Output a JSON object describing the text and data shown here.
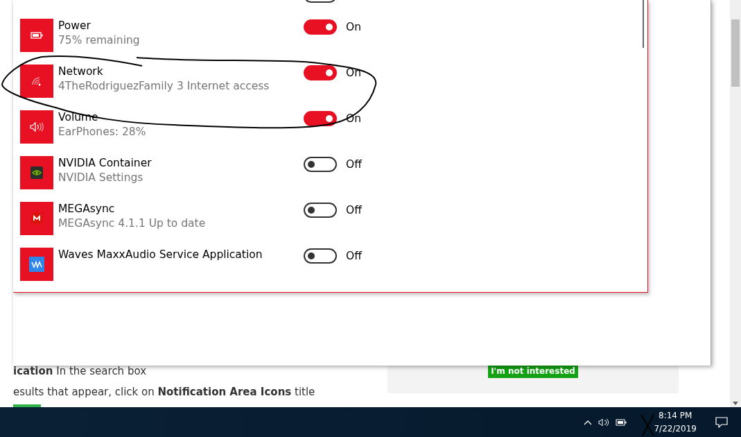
{
  "background_page": {
    "steps": [
      "**ication** In the search box",
      "esults that appear, click on **Notification Area Icons** title"
    ],
    "dismiss_button": "I'm not interested"
  },
  "panel": {
    "top_toggle": {
      "on": false
    },
    "items": [
      {
        "name": "Power",
        "detail": "75% remaining",
        "on": true,
        "state": "On",
        "kind": "battery"
      },
      {
        "name": "Network",
        "detail": "4TheRodriguezFamily 3 Internet access",
        "on": true,
        "state": "On",
        "kind": "wifi"
      },
      {
        "name": "Volume",
        "detail": "EarPhones: 28%",
        "on": true,
        "state": "On",
        "kind": "speaker"
      },
      {
        "name": "NVIDIA Container",
        "detail": "NVIDIA Settings",
        "on": false,
        "state": "Off",
        "kind": "nvidia"
      },
      {
        "name": "MEGAsync",
        "detail": "MEGAsync 4.1.1 Up to date",
        "on": false,
        "state": "Off",
        "kind": "mega"
      },
      {
        "name": "Waves MaxxAudio Service Application",
        "on": false,
        "state": "Off",
        "kind": "waves"
      }
    ]
  },
  "taskbar": {
    "time": "8:14 PM",
    "date": "7/22/2019"
  }
}
